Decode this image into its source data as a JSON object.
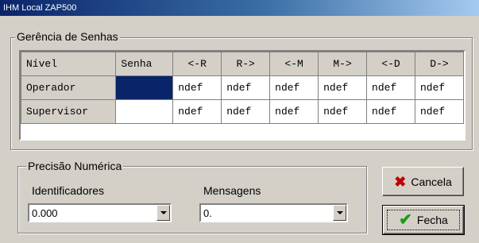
{
  "window": {
    "title": "IHM Local ZAP500"
  },
  "passwords_group": {
    "label": "Gerência de Senhas",
    "columns": [
      "Nível",
      "Senha",
      "<-R",
      "R->",
      "<-M",
      "M->",
      "<-D",
      "D->"
    ],
    "rows": [
      {
        "nivel": "Operador",
        "senha": "",
        "cells": [
          "ndef",
          "ndef",
          "ndef",
          "ndef",
          "ndef",
          "ndef"
        ]
      },
      {
        "nivel": "Supervisor",
        "senha": "",
        "cells": [
          "ndef",
          "ndef",
          "ndef",
          "ndef",
          "ndef",
          "ndef"
        ]
      }
    ]
  },
  "precision_group": {
    "label": "Precisão Numérica",
    "identifiers": {
      "label": "Identificadores",
      "value": "0.000"
    },
    "messages": {
      "label": "Mensagens",
      "value": "0."
    }
  },
  "buttons": {
    "cancel_label": "Cancela",
    "close_label": "Fecha"
  },
  "icons": {
    "cancel": "x-icon",
    "close": "check-icon"
  }
}
